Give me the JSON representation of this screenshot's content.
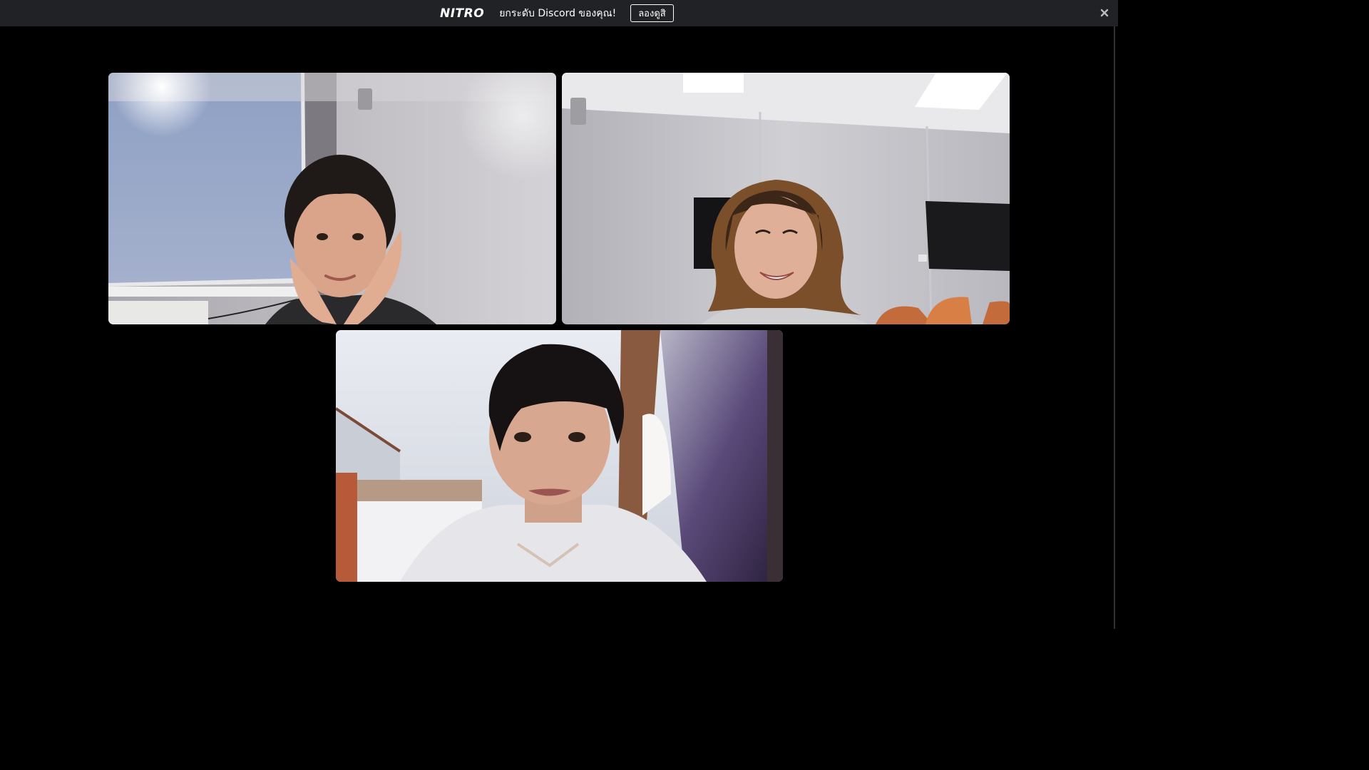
{
  "banner": {
    "logo_text": "NITRO",
    "message": "ยกระดับ Discord ของคุณ!",
    "try_button_label": "ลองดูสิ",
    "close_icon": "close-icon"
  },
  "video_tiles": [
    {
      "id": "participant-1-video",
      "depicts": "webcam-feed"
    },
    {
      "id": "participant-2-video",
      "depicts": "webcam-feed"
    },
    {
      "id": "participant-3-video",
      "depicts": "webcam-feed"
    }
  ],
  "colors": {
    "banner_bg": "#202225",
    "stage_bg": "#000000",
    "text": "#ffffff"
  }
}
